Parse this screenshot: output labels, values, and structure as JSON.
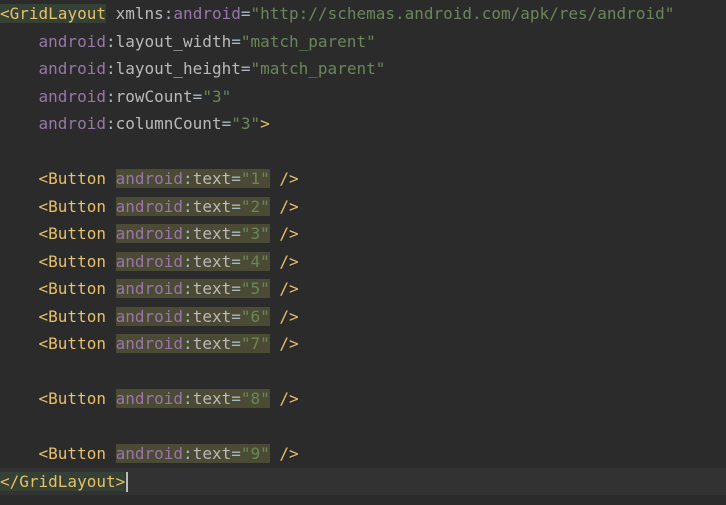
{
  "editor": {
    "language": "xml",
    "lines": [
      {
        "tag_open": "<",
        "tag_name": "GridLayout",
        "attr": "xmlns",
        "ns": "android",
        "value": "\"http://schemas.android.com/apk/res/android\""
      },
      {
        "indent": "    ",
        "ns": "android",
        "colon": ":",
        "attr": "layout_width",
        "eq": "=",
        "value": "\"match_parent\""
      },
      {
        "indent": "    ",
        "ns": "android",
        "colon": ":",
        "attr": "layout_height",
        "eq": "=",
        "value": "\"match_parent\""
      },
      {
        "indent": "    ",
        "ns": "android",
        "colon": ":",
        "attr": "rowCount",
        "eq": "=",
        "value": "\"3\""
      },
      {
        "indent": "    ",
        "ns": "android",
        "colon": ":",
        "attr": "columnCount",
        "eq": "=",
        "value": "\"3\"",
        "close": ">"
      },
      {
        "blank": true
      },
      {
        "indent": "    ",
        "tag": "<Button",
        "ns": "android",
        "colon": ":",
        "attr": "text",
        "eq": "=",
        "value": "\"1\"",
        "close": "/>"
      },
      {
        "indent": "    ",
        "tag": "<Button",
        "ns": "android",
        "colon": ":",
        "attr": "text",
        "eq": "=",
        "value": "\"2\"",
        "close": "/>"
      },
      {
        "indent": "    ",
        "tag": "<Button",
        "ns": "android",
        "colon": ":",
        "attr": "text",
        "eq": "=",
        "value": "\"3\"",
        "close": "/>"
      },
      {
        "indent": "    ",
        "tag": "<Button",
        "ns": "android",
        "colon": ":",
        "attr": "text",
        "eq": "=",
        "value": "\"4\"",
        "close": "/>"
      },
      {
        "indent": "    ",
        "tag": "<Button",
        "ns": "android",
        "colon": ":",
        "attr": "text",
        "eq": "=",
        "value": "\"5\"",
        "close": "/>"
      },
      {
        "indent": "    ",
        "tag": "<Button",
        "ns": "android",
        "colon": ":",
        "attr": "text",
        "eq": "=",
        "value": "\"6\"",
        "close": "/>"
      },
      {
        "indent": "    ",
        "tag": "<Button",
        "ns": "android",
        "colon": ":",
        "attr": "text",
        "eq": "=",
        "value": "\"7\"",
        "close": "/>"
      },
      {
        "blank": true
      },
      {
        "indent": "    ",
        "tag": "<Button",
        "ns": "android",
        "colon": ":",
        "attr": "text",
        "eq": "=",
        "value": "\"8\"",
        "close": "/>"
      },
      {
        "blank": true
      },
      {
        "indent": "    ",
        "tag": "<Button",
        "ns": "android",
        "colon": ":",
        "attr": "text",
        "eq": "=",
        "value": "\"9\"",
        "close": "/>"
      },
      {
        "closing_tag": "</GridLayout>"
      }
    ],
    "colors": {
      "background": "#2b2b2b",
      "current_line": "#323232",
      "tag": "#e8bf6a",
      "namespace": "#9876aa",
      "attribute": "#bababa",
      "string": "#6a8759",
      "attr_highlight": "#4a4a35",
      "tag_match_highlight": "#344134"
    }
  }
}
